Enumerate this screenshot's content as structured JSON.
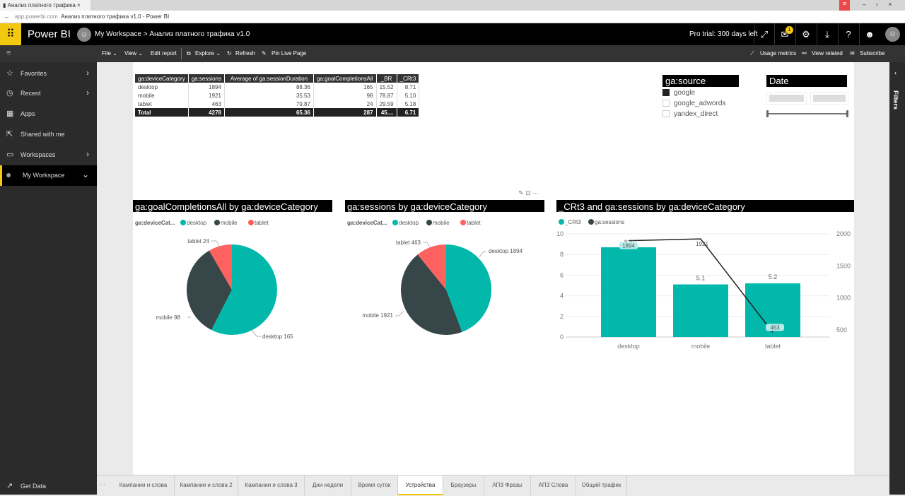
{
  "browser": {
    "tab_title": "Анализ платного трафика",
    "url": "app.powerbi.com",
    "page_title": "Анализ платного трафика v1.0 - Power BI"
  },
  "header": {
    "brand": "Power BI",
    "workspace": "My Workspace",
    "separator": ">",
    "report": "Анализ платного трафика v1.0",
    "trial": "Pro trial: 300 days left",
    "notification_count": "1"
  },
  "toolbar": {
    "left": [
      "File ⌄",
      "View ⌄",
      "Edit report",
      "Explore ⌄",
      "Refresh",
      "Pin Live Page"
    ],
    "right": [
      "Usage metrics",
      "View related",
      "Subscribe"
    ]
  },
  "sidebar": {
    "items": [
      {
        "label": "Favorites",
        "icon": "☆"
      },
      {
        "label": "Recent",
        "icon": "◷"
      },
      {
        "label": "Apps",
        "icon": "▦"
      },
      {
        "label": "Shared with me",
        "icon": "⇱"
      },
      {
        "label": "Workspaces",
        "icon": "▭"
      },
      {
        "label": "My Workspace",
        "icon": "●"
      }
    ],
    "get_data": "Get Data"
  },
  "filters_label": "Filters",
  "table": {
    "headers": [
      "ga:deviceCategory",
      "ga:sessions",
      "Average of ga:sessionDuration",
      "ga:goalCompletionsAll",
      "_BR",
      "_CRt3"
    ],
    "rows": [
      [
        "desktop",
        "1894",
        "88.36",
        "165",
        "15.52",
        "8.71"
      ],
      [
        "mobile",
        "1921",
        "35.53",
        "98",
        "78.87",
        "5.10"
      ],
      [
        "tablet",
        "463",
        "79.87",
        "24",
        "29.59",
        "5.18"
      ]
    ],
    "total": [
      "Total",
      "4278",
      "65.36",
      "287",
      "45....",
      "6.71"
    ]
  },
  "slicer_source": {
    "title": "ga:source",
    "options": [
      {
        "label": "google",
        "checked": true
      },
      {
        "label": "google_adwords",
        "checked": false
      },
      {
        "label": "yandex_direct",
        "checked": false
      }
    ]
  },
  "slicer_date": {
    "title": "Date"
  },
  "colors": {
    "desktop": "#01b8aa",
    "mobile": "#374649",
    "tablet": "#fd625e"
  },
  "chart_data": [
    {
      "type": "pie",
      "title": "ga:goalCompletionsAll by ga:deviceCategory",
      "legend_title": "ga:deviceCat...",
      "categories": [
        "desktop",
        "mobile",
        "tablet"
      ],
      "values": [
        165,
        98,
        24
      ]
    },
    {
      "type": "pie",
      "title": "ga:sessions by ga:deviceCategory",
      "legend_title": "ga:deviceCat...",
      "categories": [
        "desktop",
        "mobile",
        "tablet"
      ],
      "values": [
        1894,
        1921,
        463
      ]
    },
    {
      "type": "bar+line",
      "title": "_CRt3 and ga:sessions by ga:deviceCategory",
      "categories": [
        "desktop",
        "mobile",
        "tablet"
      ],
      "series": [
        {
          "name": "_CRt3",
          "type": "bar",
          "values": [
            8.7,
            5.1,
            5.2
          ]
        },
        {
          "name": "ga:sessions",
          "type": "line",
          "values": [
            1894,
            1921,
            463
          ]
        }
      ],
      "y_left": {
        "ticks": [
          0,
          2,
          4,
          6,
          8,
          10
        ],
        "range": [
          0,
          10
        ]
      },
      "y_right": {
        "ticks": [
          500,
          1000,
          1500,
          2000
        ],
        "range": [
          390,
          2000
        ]
      },
      "legend": "top-left"
    }
  ],
  "pages": [
    "Кампании и слова",
    "Кампании и слова 2",
    "Кампании и слова 3",
    "Дни недели",
    "Время суток",
    "Устройства",
    "Браузеры",
    "АПЗ Фразы",
    "АПЗ Слова",
    "Общий трафик"
  ],
  "active_page": "Устройства"
}
